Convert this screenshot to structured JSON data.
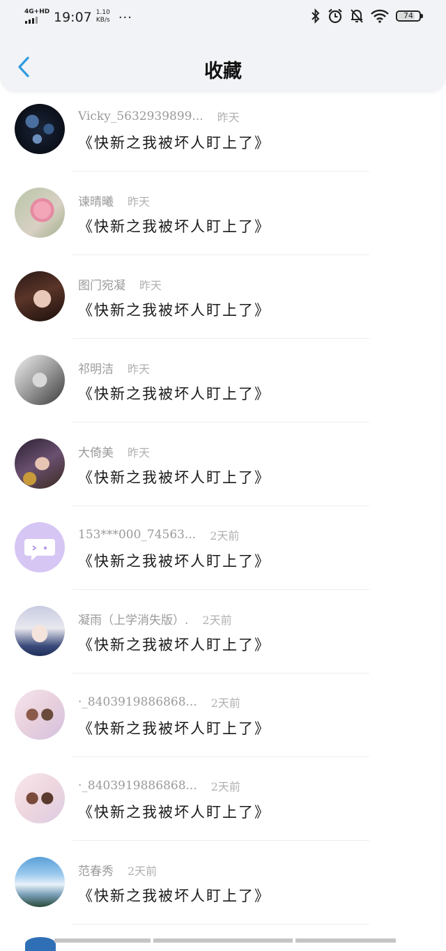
{
  "status_bar": {
    "network": "4G+HD",
    "time": "19:07",
    "speed_value": "1.10",
    "speed_unit": "KB/s",
    "dots": "···",
    "battery": "74"
  },
  "header": {
    "back_icon": "chevron-left-icon",
    "title": "收藏"
  },
  "colors": {
    "accent": "#2e9be0",
    "header_bg": "#f1f3f6",
    "name_gray": "#9a9a9a",
    "message": "#1a1a1a"
  },
  "items": [
    {
      "name": "Vicky_5632939899...",
      "time": "昨天",
      "message": "《快新之我被坏人盯上了》"
    },
    {
      "name": "谏晴曦",
      "time": "昨天",
      "message": "《快新之我被坏人盯上了》"
    },
    {
      "name": "图门宛凝",
      "time": "昨天",
      "message": "《快新之我被坏人盯上了》"
    },
    {
      "name": "祁明洁",
      "time": "昨天",
      "message": "《快新之我被坏人盯上了》"
    },
    {
      "name": "大倚美",
      "time": "昨天",
      "message": "《快新之我被坏人盯上了》"
    },
    {
      "name": "153***000_74563...",
      "time": "2天前",
      "message": "《快新之我被坏人盯上了》"
    },
    {
      "name": "凝雨（上学消失版）.",
      "time": "2天前",
      "message": "《快新之我被坏人盯上了》"
    },
    {
      "name": "·_8403919886868...",
      "time": "2天前",
      "message": "《快新之我被坏人盯上了》"
    },
    {
      "name": "·_8403919886868...",
      "time": "2天前",
      "message": "《快新之我被坏人盯上了》"
    },
    {
      "name": "范春秀",
      "time": "2天前",
      "message": "《快新之我被坏人盯上了》"
    }
  ]
}
